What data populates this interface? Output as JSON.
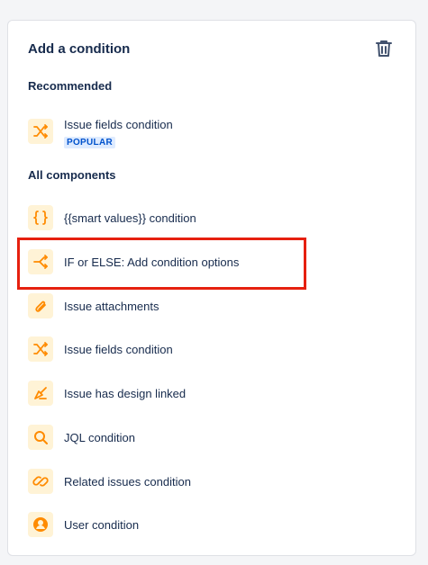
{
  "panel": {
    "title": "Add a condition",
    "delete_icon": "trash-icon"
  },
  "recommended": {
    "heading": "Recommended",
    "items": [
      {
        "label": "Issue fields condition",
        "badge": "POPULAR",
        "icon": "shuffle-icon"
      }
    ]
  },
  "all_components": {
    "heading": "All components",
    "items": [
      {
        "label": "{{smart values}} condition",
        "icon": "curly-braces-icon"
      },
      {
        "label": "IF or ELSE: Add condition options",
        "icon": "branch-icon",
        "highlighted": true
      },
      {
        "label": "Issue attachments",
        "icon": "paperclip-icon"
      },
      {
        "label": "Issue fields condition",
        "icon": "shuffle-icon"
      },
      {
        "label": "Issue has design linked",
        "icon": "design-pen-icon"
      },
      {
        "label": "JQL condition",
        "icon": "search-icon"
      },
      {
        "label": "Related issues condition",
        "icon": "link-icon"
      },
      {
        "label": "User condition",
        "icon": "user-icon"
      }
    ]
  },
  "colors": {
    "icon_tile_bg": "#fff3d6",
    "icon_color": "#ff8b00",
    "badge_text": "#0052cc",
    "badge_bg": "#deebff",
    "highlight_border": "#e6200f"
  }
}
